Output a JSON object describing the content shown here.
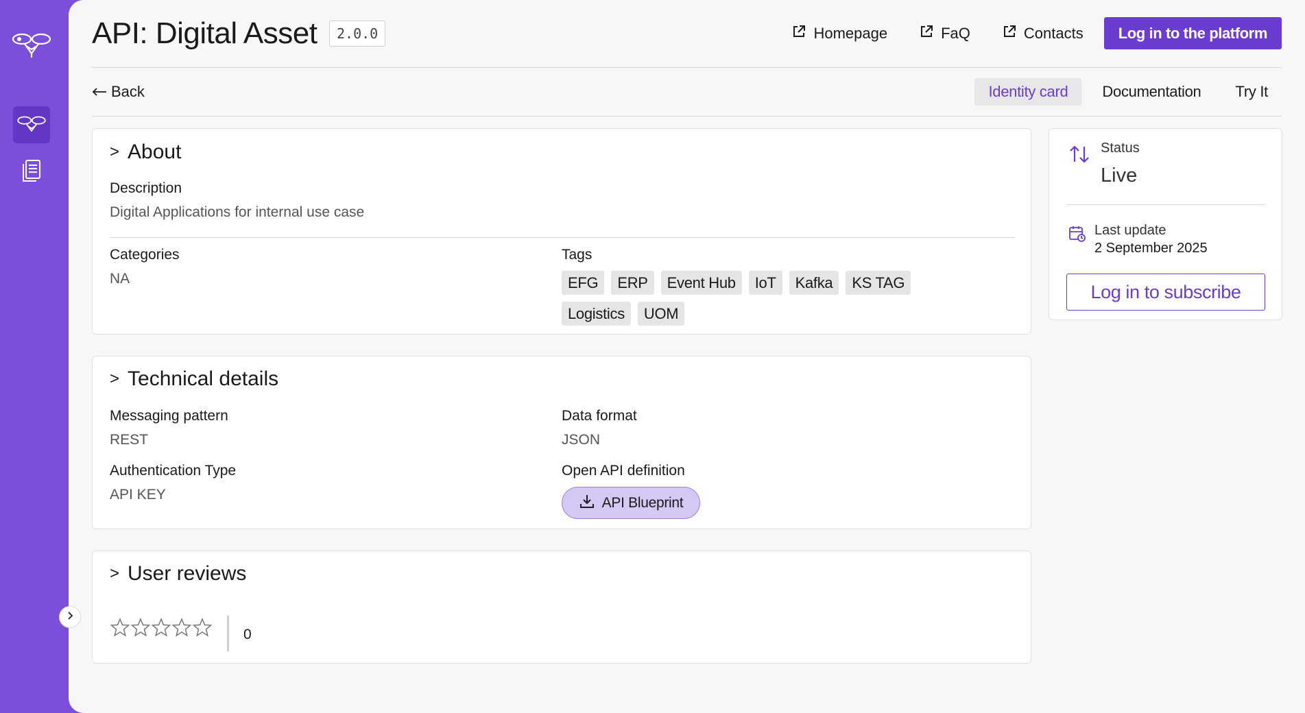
{
  "sidebar": {
    "logo_icon": "bee-logo-icon",
    "items": [
      {
        "icon": "bee-icon",
        "active": true
      },
      {
        "icon": "documents-icon",
        "active": false
      }
    ],
    "toggle_icon": "chevron-right-icon"
  },
  "header": {
    "title": "API: Digital Asset",
    "version": "2.0.0",
    "links": [
      {
        "label": "Homepage",
        "icon": "external-link-icon"
      },
      {
        "label": "FaQ",
        "icon": "external-link-icon"
      },
      {
        "label": "Contacts",
        "icon": "external-link-icon"
      }
    ],
    "login_label": "Log in to the platform"
  },
  "subnav": {
    "back_label": "Back",
    "tabs": [
      {
        "label": "Identity card",
        "active": true
      },
      {
        "label": "Documentation",
        "active": false
      },
      {
        "label": "Try It",
        "active": false
      }
    ]
  },
  "about": {
    "title": "About",
    "description_label": "Description",
    "description": "Digital Applications for internal use case",
    "categories_label": "Categories",
    "categories": "NA",
    "tags_label": "Tags",
    "tags": [
      "EFG",
      "ERP",
      "Event Hub",
      "IoT",
      "Kafka",
      "KS TAG",
      "Logistics",
      "UOM"
    ]
  },
  "technical": {
    "title": "Technical details",
    "messaging_label": "Messaging pattern",
    "messaging": "REST",
    "data_format_label": "Data format",
    "data_format": "JSON",
    "auth_label": "Authentication Type",
    "auth": "API KEY",
    "openapi_label": "Open API definition",
    "blueprint_label": "API Blueprint"
  },
  "reviews": {
    "title": "User reviews",
    "rating": 0,
    "max_rating": 5,
    "count": "0"
  },
  "status": {
    "status_label": "Status",
    "status": "Live",
    "last_update_label": "Last update",
    "last_update": "2 September 2025",
    "subscribe_label": "Log in to subscribe"
  },
  "colors": {
    "brand": "#7B4FD9",
    "accent": "#6A3CCF",
    "blueprint_bg": "#d5c8f4"
  }
}
